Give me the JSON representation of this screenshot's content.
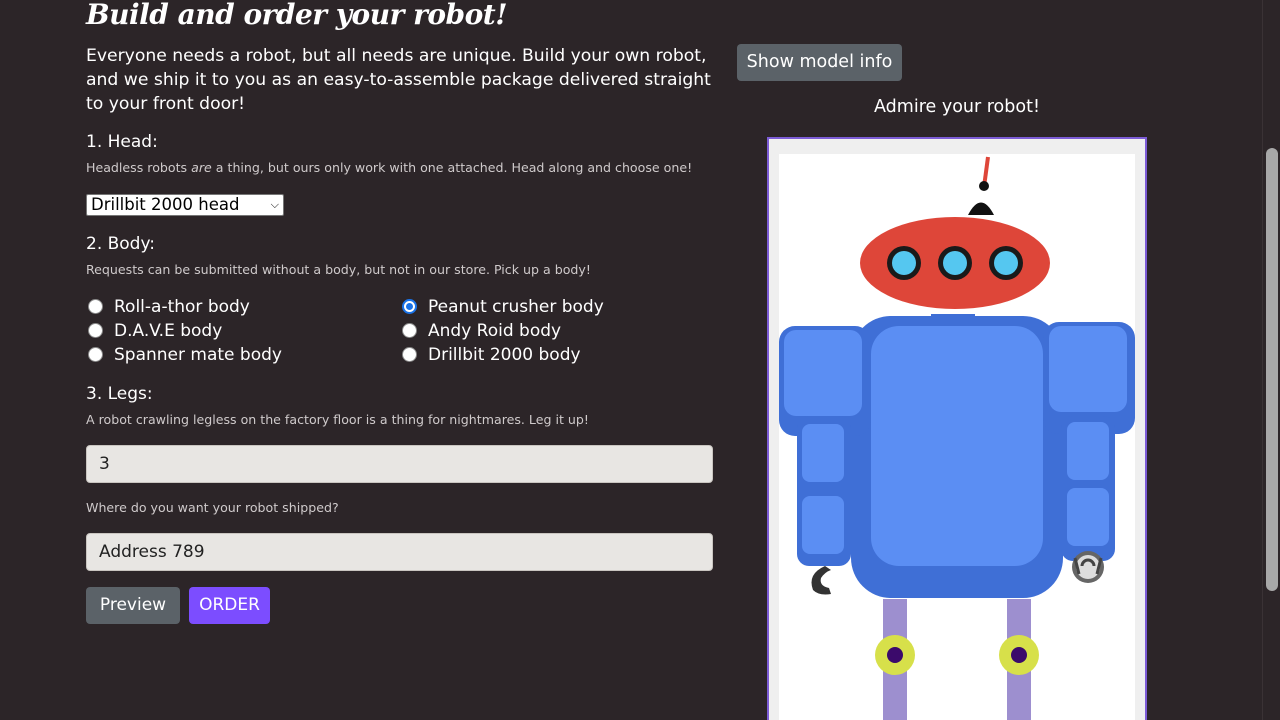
{
  "title": "Build and order your robot!",
  "intro": "Everyone needs a robot, but all needs are unique. Build your own robot, and we ship it to you as an easy-to-assemble package delivered straight to your front door!",
  "head": {
    "heading": "1. Head:",
    "help_before": "Headless robots ",
    "help_em": "are",
    "help_after": " a thing, but ours only work with one attached. Head along and choose one!",
    "selected": "Drillbit 2000 head"
  },
  "body": {
    "heading": "2. Body:",
    "help": "Requests can be submitted without a body, but not in our store. Pick up a body!",
    "options": [
      {
        "label": "Roll-a-thor body",
        "checked": false
      },
      {
        "label": "Peanut crusher body",
        "checked": true
      },
      {
        "label": "D.A.V.E body",
        "checked": false
      },
      {
        "label": "Andy Roid body",
        "checked": false
      },
      {
        "label": "Spanner mate body",
        "checked": false
      },
      {
        "label": "Drillbit 2000 body",
        "checked": false
      }
    ]
  },
  "legs": {
    "heading": "3. Legs:",
    "help": "A robot crawling legless on the factory floor is a thing for nightmares. Leg it up!",
    "value": "3"
  },
  "shipping": {
    "help": "Where do you want your robot shipped?",
    "value": "Address 789"
  },
  "buttons": {
    "preview": "Preview",
    "order": "ORDER",
    "model_info": "Show model info"
  },
  "preview_caption": "Admire your robot!",
  "colors": {
    "background": "#2c2528",
    "accent": "#7c4dff",
    "secondary_button": "#5b6268",
    "robot_head": "#de4639",
    "robot_body": "#5b8ef3",
    "robot_legs": "#9d8fcf"
  }
}
